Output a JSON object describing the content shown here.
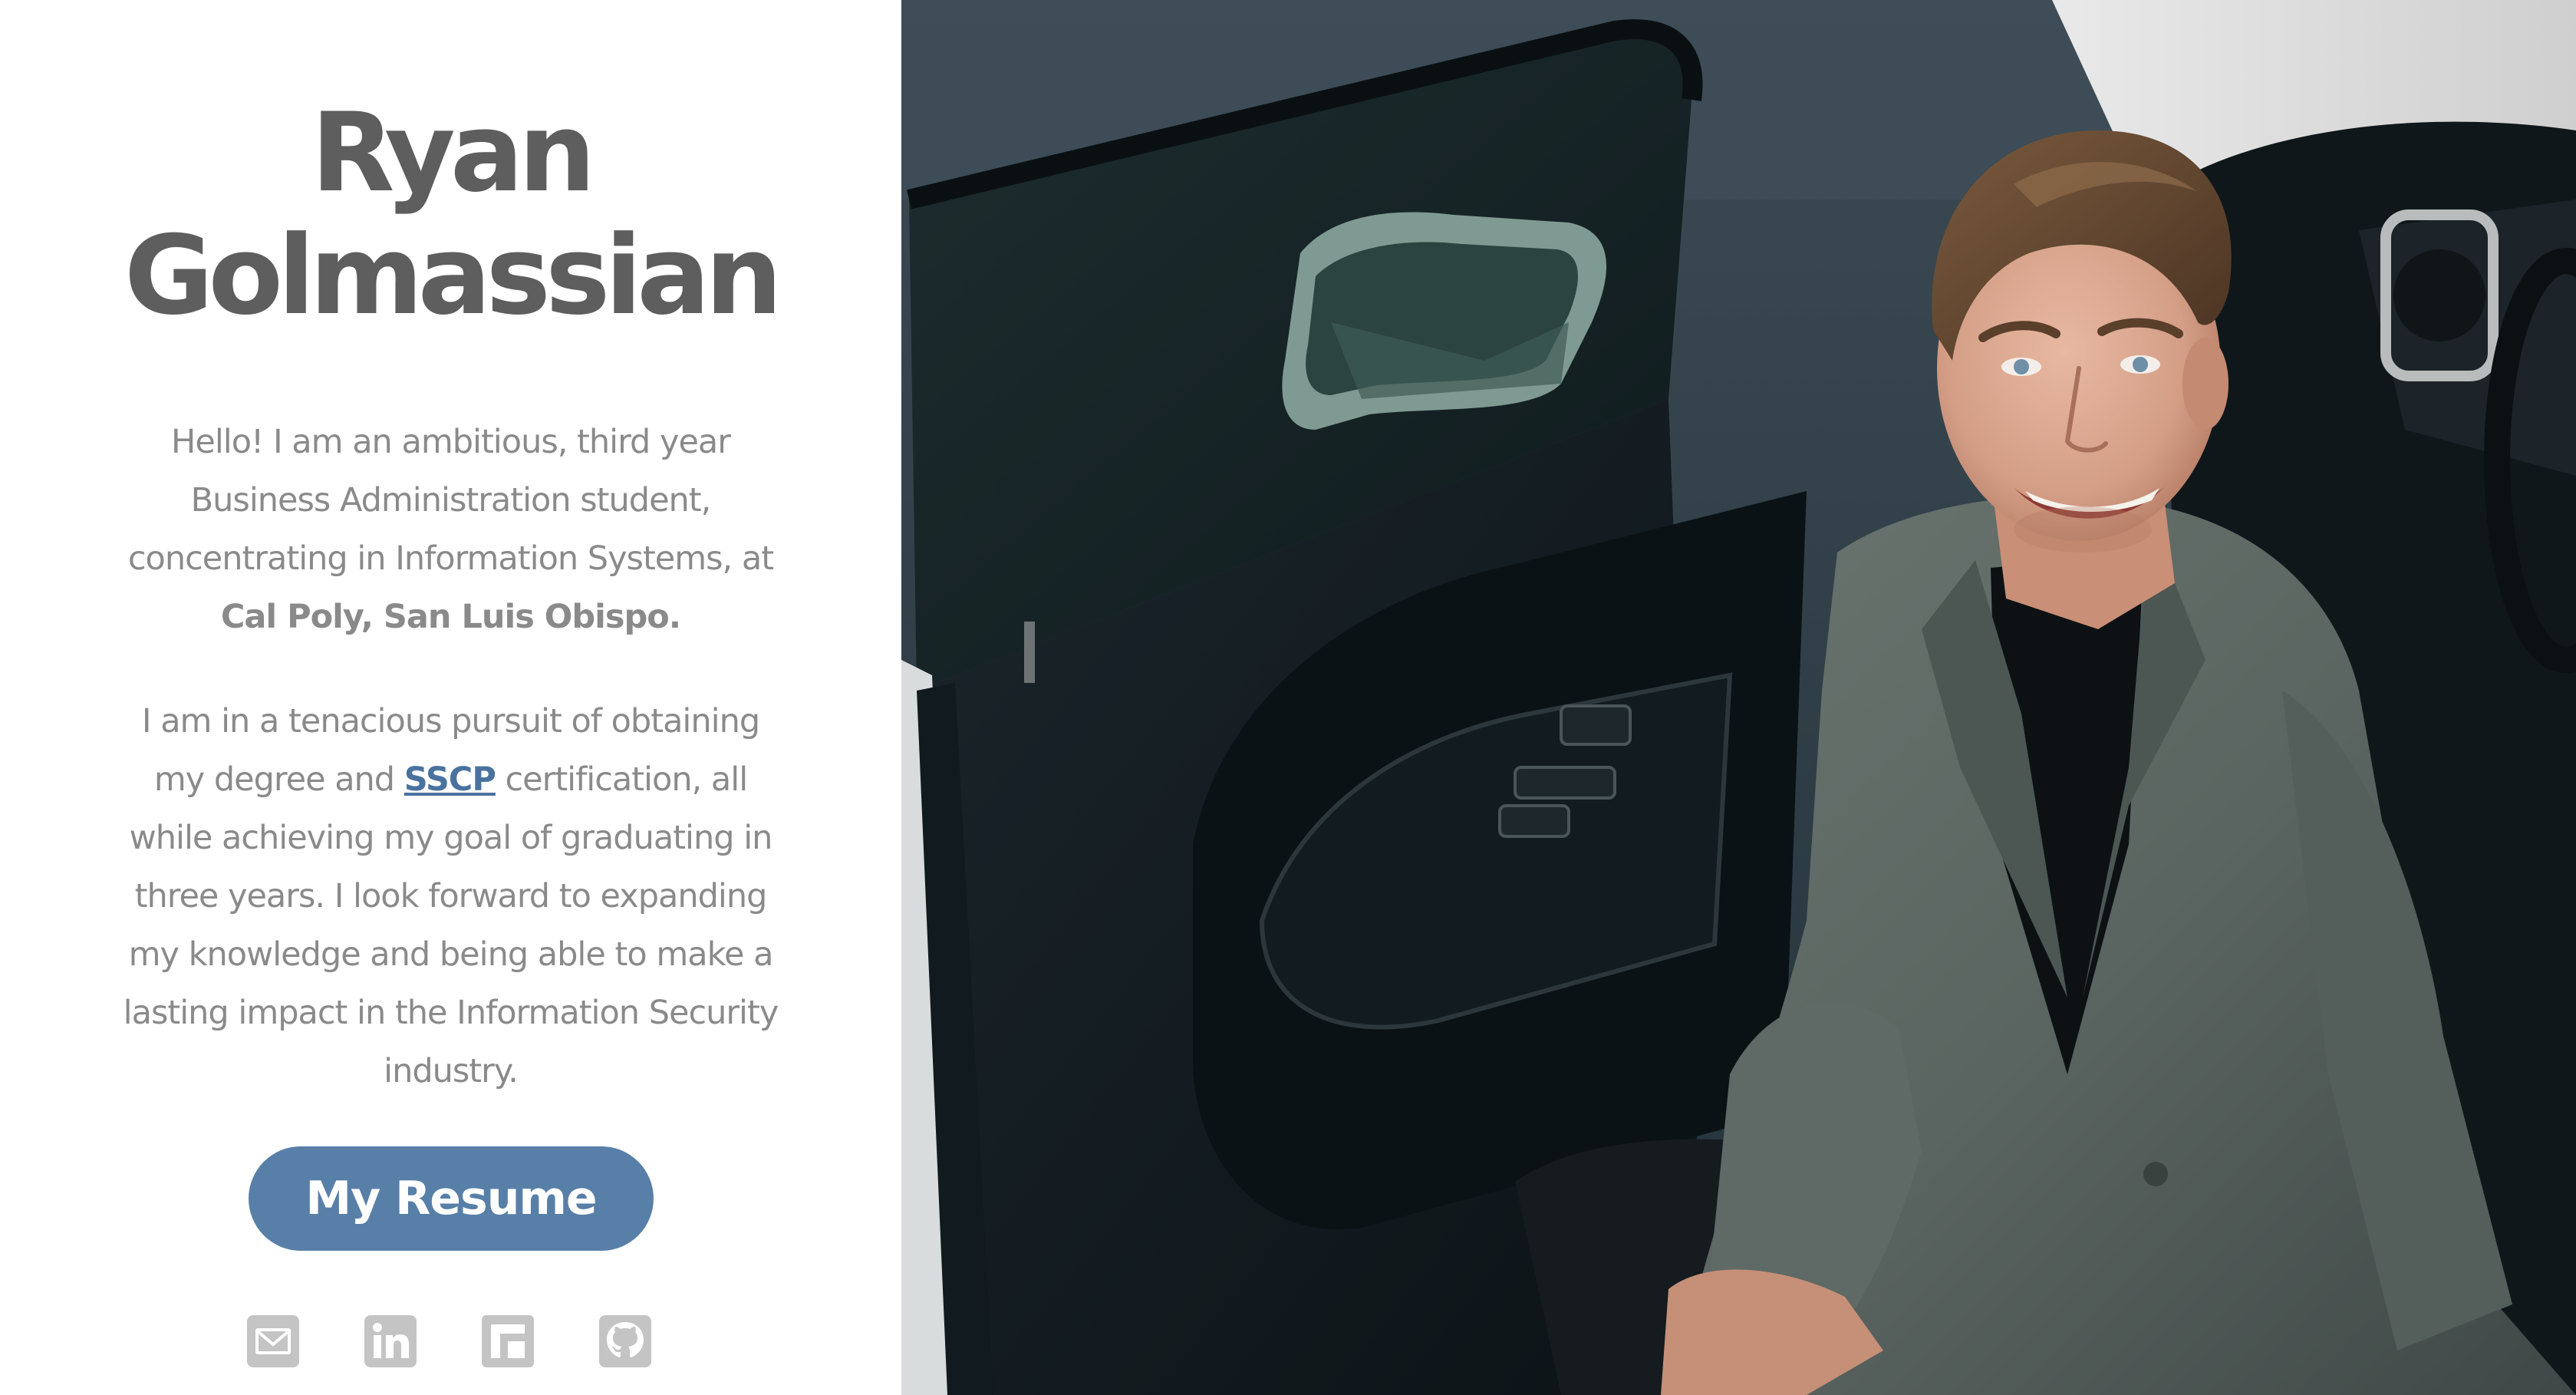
{
  "profile": {
    "first_name": "Ryan",
    "last_name": "Golmassian"
  },
  "bio": {
    "p1_text": "Hello! I am an ambitious, third year Business Administration student, concentrating in Information Systems, at ",
    "p1_bold": "Cal Poly, San Luis Obispo.",
    "p2_before": "I am in a tenacious pursuit of obtaining my degree and ",
    "p2_link": "SSCP",
    "p2_after": " certification, all while achieving my goal of graduating in three years. I look forward to expanding my knowledge and being able to make a lasting impact in the Information Security industry."
  },
  "resume_button": {
    "label": "My Resume"
  },
  "social": {
    "icons": [
      "email-icon",
      "linkedin-icon",
      "flipboard-icon",
      "github-icon"
    ],
    "icon_color": "#c4c4c4"
  },
  "colors": {
    "name": "#5e5e5e",
    "body_text": "#8a8a8a",
    "link": "#4a729e",
    "button_bg": "#587fa8",
    "button_text": "#ffffff"
  }
}
